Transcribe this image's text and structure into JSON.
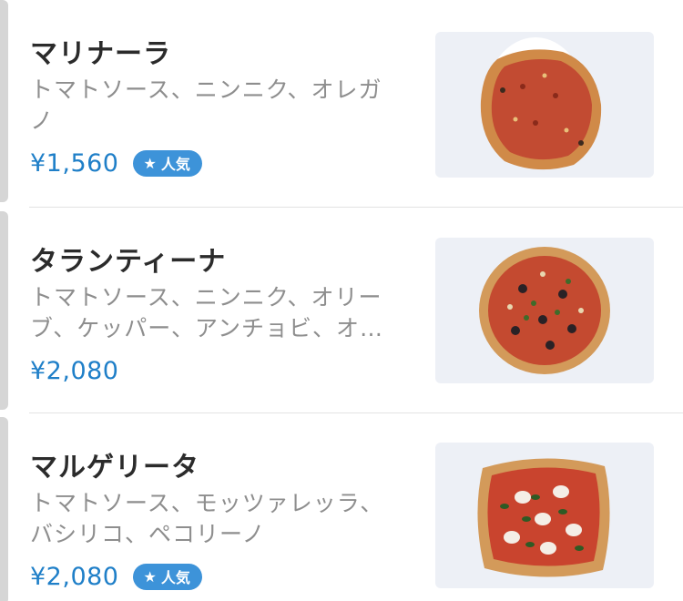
{
  "menu": {
    "items": [
      {
        "name": "マリナーラ",
        "description": "トマトソース、ニンニク、オレガノ",
        "price": "¥1,560",
        "badge": "人気",
        "photo_icon": "pizza-marinara"
      },
      {
        "name": "タランティーナ",
        "description": "トマトソース、ニンニク、オリーブ、ケッパー、アンチョビ、オ…",
        "price": "¥2,080",
        "badge": "",
        "photo_icon": "pizza-tarantina"
      },
      {
        "name": "マルゲリータ",
        "description": "トマトソース、モッツァレッラ、バシリコ、ペコリーノ",
        "price": "¥2,080",
        "badge": "人気",
        "photo_icon": "pizza-margherita"
      }
    ]
  },
  "colors": {
    "price": "#1f7fc8",
    "badge_bg": "#3d93d9",
    "tomato": "#c9442e",
    "crust": "#d4924c"
  }
}
